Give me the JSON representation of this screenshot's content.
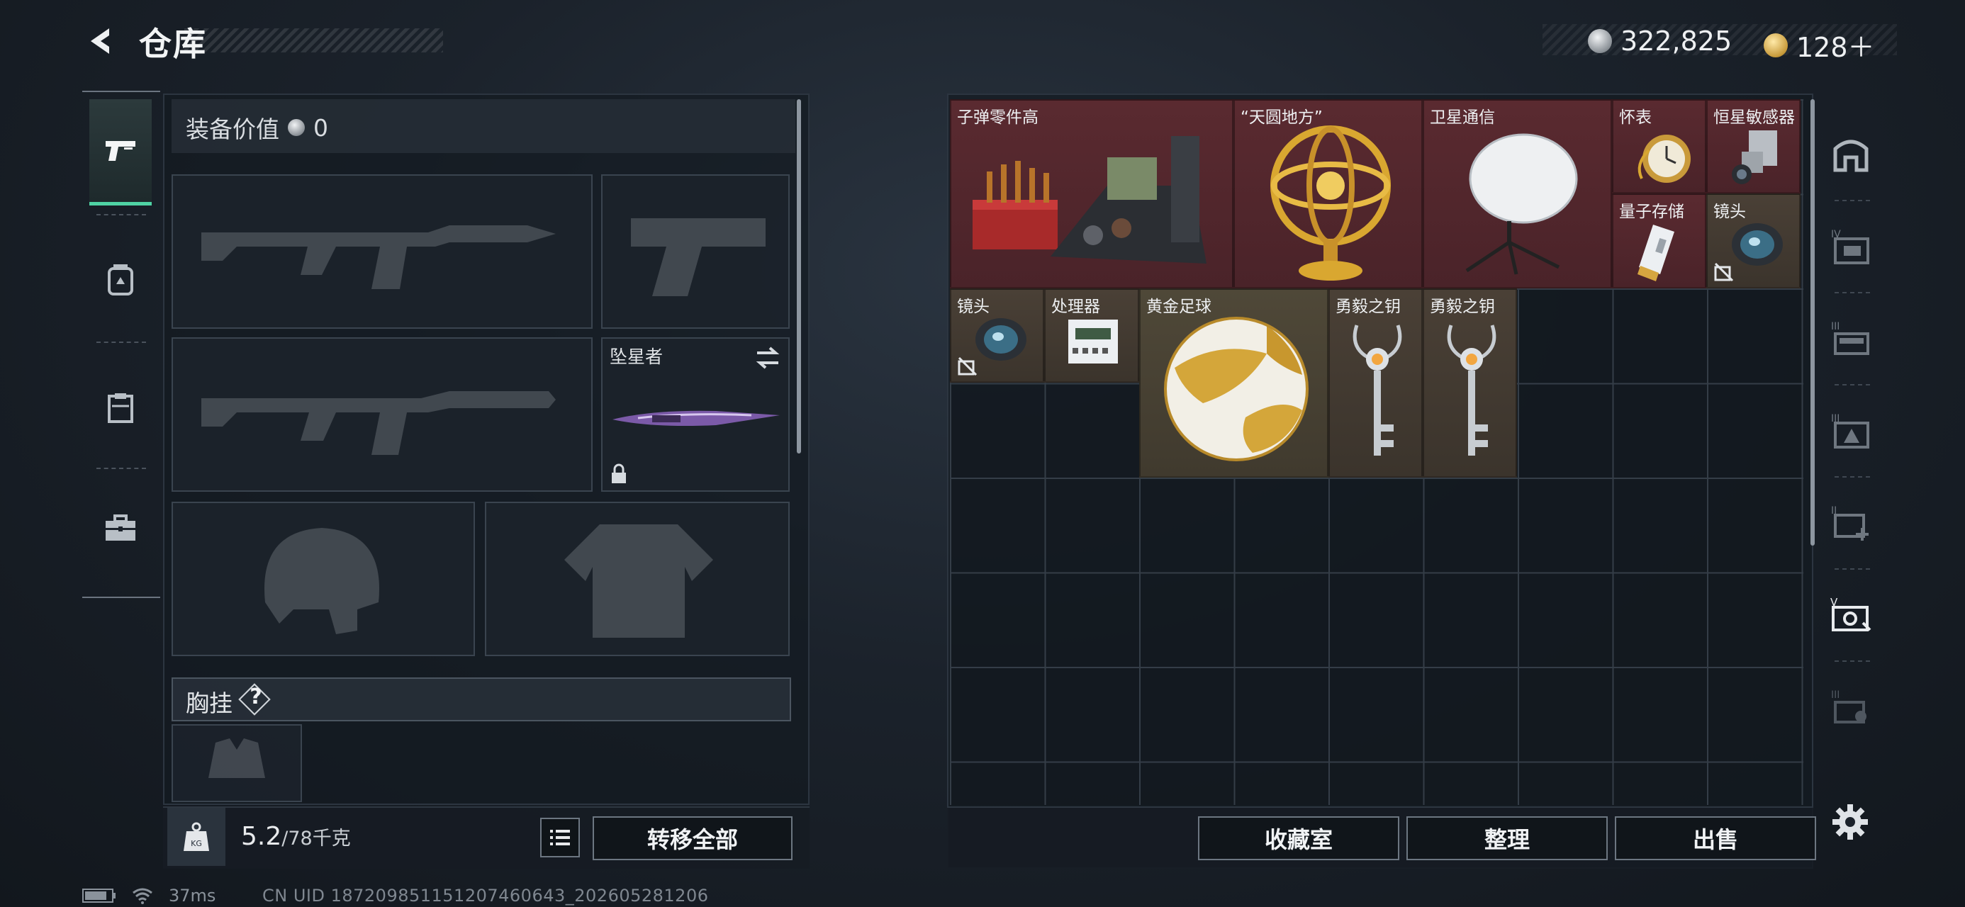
{
  "header": {
    "title": "仓库",
    "currency_silver": "322,825",
    "currency_gold": "128＋"
  },
  "left": {
    "equip_value_label": "装备价值",
    "equip_value": "0",
    "melee_slot_label": "坠星者",
    "chest_rig_label": "胸挂",
    "help_symbol": "?",
    "weight_current": "5.2",
    "weight_max": "/78千克",
    "transfer_all": "转移全部"
  },
  "items": [
    {
      "name": "子弹零件高",
      "color": "red"
    },
    {
      "name": "“天圆地方”",
      "color": "red"
    },
    {
      "name": "卫星通信",
      "color": "red"
    },
    {
      "name": "怀表",
      "color": "red"
    },
    {
      "name": "恒星敏感器",
      "color": "red"
    },
    {
      "name": "量子存储",
      "color": "red"
    },
    {
      "name": "镜头",
      "color": "brown"
    },
    {
      "name": "镜头",
      "color": "brown"
    },
    {
      "name": "处理器",
      "color": "brown"
    },
    {
      "name": "黄金足球",
      "color": "yellow"
    },
    {
      "name": "勇毅之钥",
      "color": "brown"
    },
    {
      "name": "勇毅之钥",
      "color": "brown"
    }
  ],
  "buttons": {
    "collection": "收藏室",
    "organize": "整理",
    "sell": "出售"
  },
  "status": {
    "ping": "37ms",
    "uid": "CN UID 18720985115120746064​3_202605281206"
  },
  "colors": {
    "accent": "#4fd3a4",
    "rare_red": "#5a2a30",
    "rare_brown": "#4a4036",
    "rare_gold": "#4f4838"
  }
}
